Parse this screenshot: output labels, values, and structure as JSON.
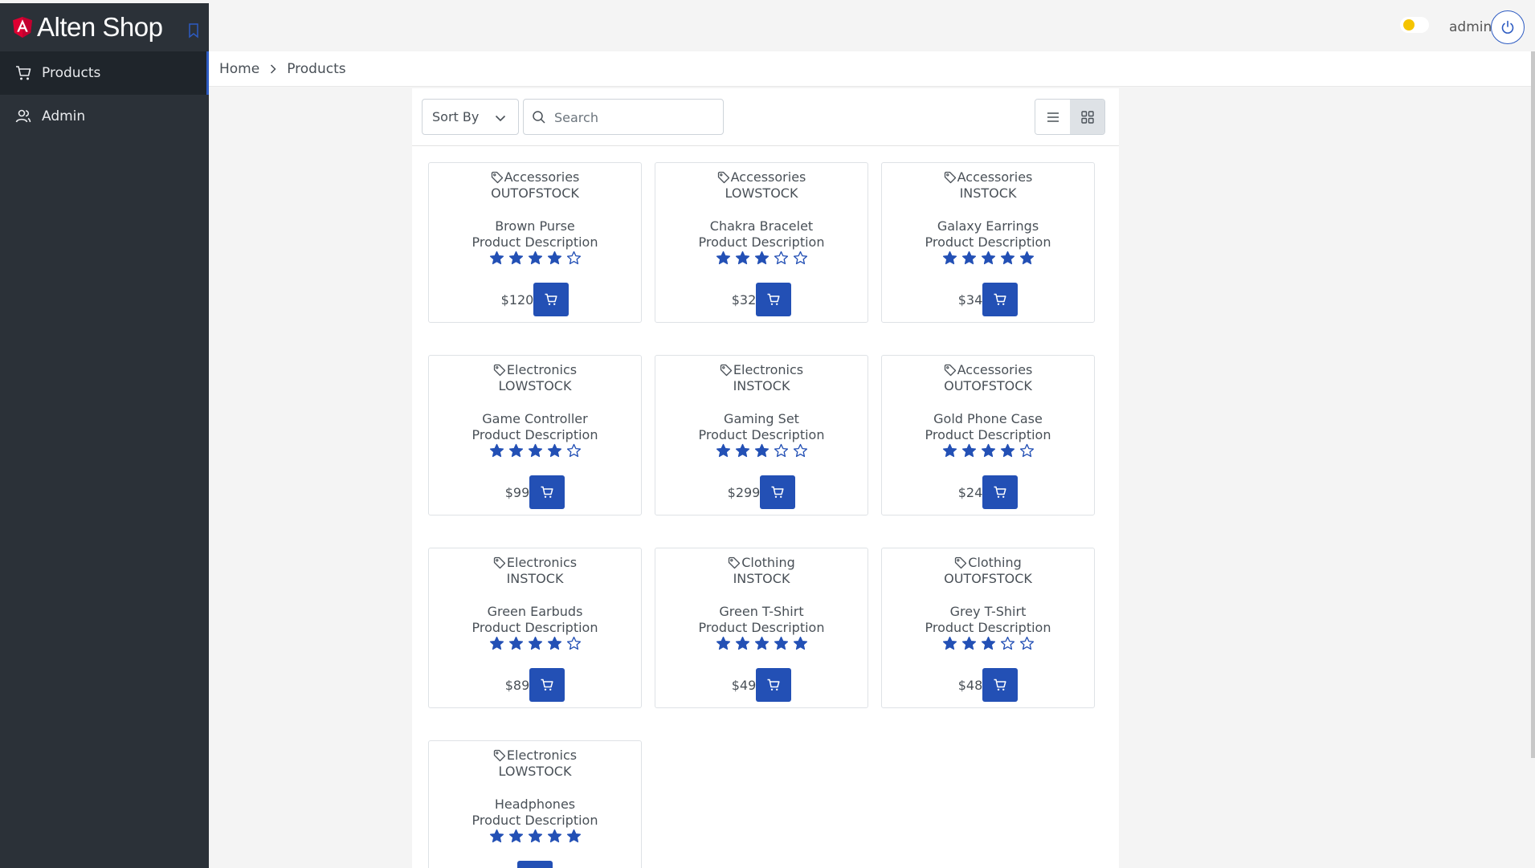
{
  "app": {
    "title": "Alten Shop",
    "accent_color": "#2d5bc2",
    "sidebar_color": "#2b3138"
  },
  "sidebar": {
    "items": [
      {
        "label": "Products",
        "icon": "cart-icon",
        "active": true
      },
      {
        "label": "Admin",
        "icon": "users-icon",
        "active": false
      }
    ]
  },
  "header": {
    "user": "admin"
  },
  "breadcrumb": [
    "Home",
    "Products"
  ],
  "toolbar": {
    "sort_label": "Sort By",
    "search_placeholder": "Search",
    "view_mode": "grid"
  },
  "products": [
    {
      "category": "Accessories",
      "stock": "OUTOFSTOCK",
      "name": "Brown Purse",
      "description": "Product Description",
      "rating": 4,
      "price": "$120"
    },
    {
      "category": "Accessories",
      "stock": "LOWSTOCK",
      "name": "Chakra Bracelet",
      "description": "Product Description",
      "rating": 3,
      "price": "$32"
    },
    {
      "category": "Accessories",
      "stock": "INSTOCK",
      "name": "Galaxy Earrings",
      "description": "Product Description",
      "rating": 5,
      "price": "$34"
    },
    {
      "category": "Electronics",
      "stock": "LOWSTOCK",
      "name": "Game Controller",
      "description": "Product Description",
      "rating": 4,
      "price": "$99"
    },
    {
      "category": "Electronics",
      "stock": "INSTOCK",
      "name": "Gaming Set",
      "description": "Product Description",
      "rating": 3,
      "price": "$299"
    },
    {
      "category": "Accessories",
      "stock": "OUTOFSTOCK",
      "name": "Gold Phone Case",
      "description": "Product Description",
      "rating": 4,
      "price": "$24"
    },
    {
      "category": "Electronics",
      "stock": "INSTOCK",
      "name": "Green Earbuds",
      "description": "Product Description",
      "rating": 4,
      "price": "$89"
    },
    {
      "category": "Clothing",
      "stock": "INSTOCK",
      "name": "Green T-Shirt",
      "description": "Product Description",
      "rating": 5,
      "price": "$49"
    },
    {
      "category": "Clothing",
      "stock": "OUTOFSTOCK",
      "name": "Grey T-Shirt",
      "description": "Product Description",
      "rating": 3,
      "price": "$48"
    },
    {
      "category": "Electronics",
      "stock": "LOWSTOCK",
      "name": "Headphones",
      "description": "Product Description",
      "rating": 5,
      "price": ""
    }
  ]
}
